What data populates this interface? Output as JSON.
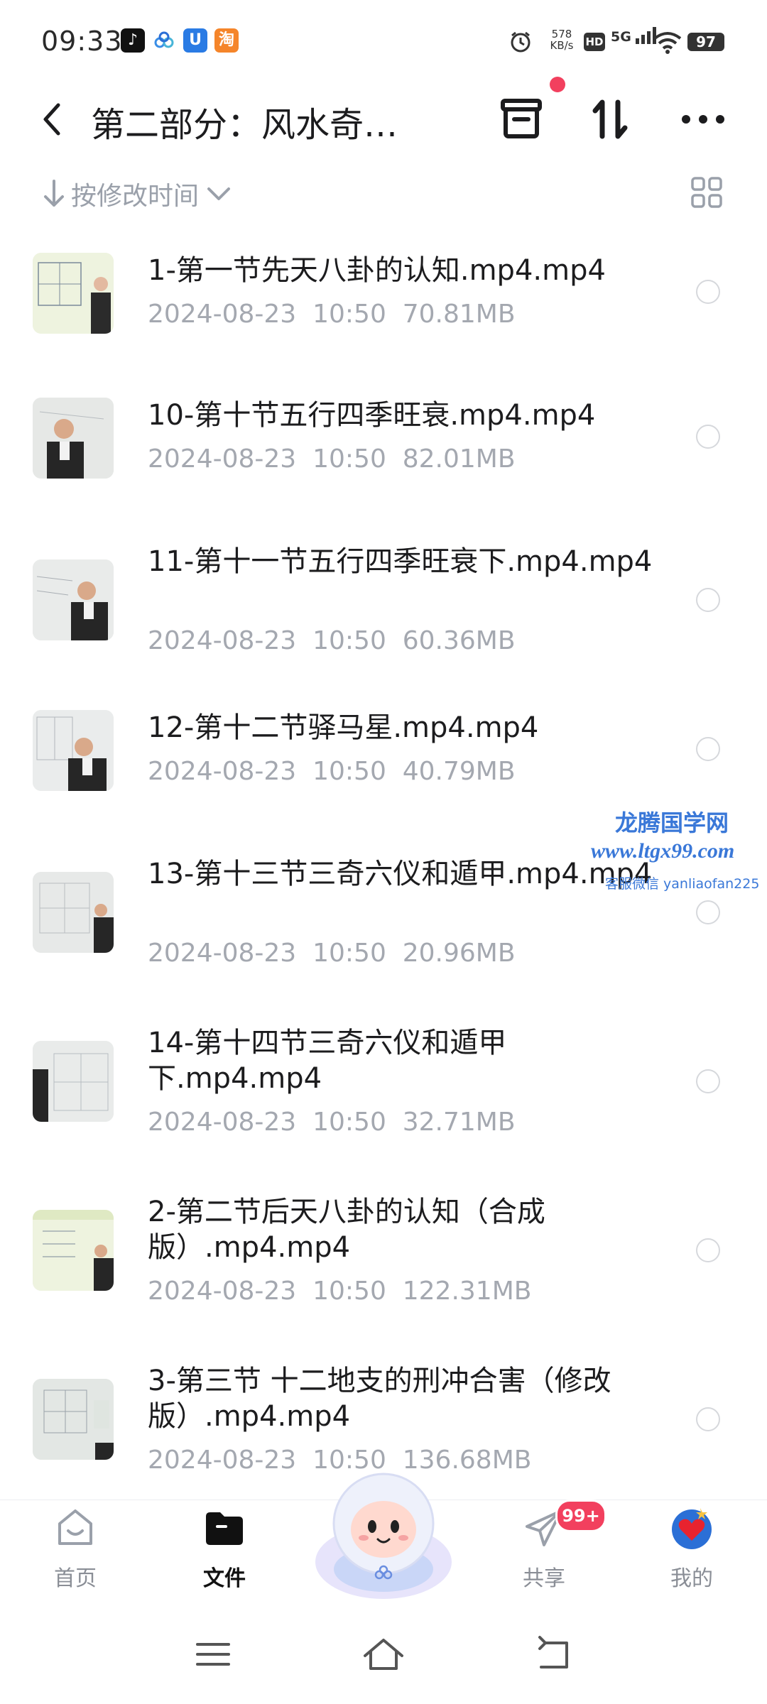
{
  "status_bar": {
    "time": "09:33",
    "apps": [
      "tiktok-icon",
      "cloud-icon",
      "shield-icon",
      "taobao-icon"
    ],
    "app_taobao": "淘",
    "speed_value": "578",
    "speed_unit": "KB/s",
    "hd": "HD",
    "network": "5G",
    "battery": "97"
  },
  "header": {
    "title": "第二部分：风水奇…"
  },
  "sort": {
    "label": "按修改时间"
  },
  "files": [
    {
      "name": "1-第一节先天八卦的认知.mp4.mp4",
      "date": "2024-08-23",
      "time": "10:50",
      "size": "70.81MB"
    },
    {
      "name": "10-第十节五行四季旺衰.mp4.mp4",
      "date": "2024-08-23",
      "time": "10:50",
      "size": "82.01MB"
    },
    {
      "name": "11-第十一节五行四季旺衰下.mp4.mp4",
      "date": "2024-08-23",
      "time": "10:50",
      "size": "60.36MB"
    },
    {
      "name": "12-第十二节驿马星.mp4.mp4",
      "date": "2024-08-23",
      "time": "10:50",
      "size": "40.79MB"
    },
    {
      "name": "13-第十三节三奇六仪和遁甲.mp4.mp4",
      "date": "2024-08-23",
      "time": "10:50",
      "size": "20.96MB"
    },
    {
      "name": "14-第十四节三奇六仪和遁甲下.mp4.mp4",
      "date": "2024-08-23",
      "time": "10:50",
      "size": "32.71MB"
    },
    {
      "name": "2-第二节后天八卦的认知（合成版）.mp4.mp4",
      "date": "2024-08-23",
      "time": "10:50",
      "size": "122.31MB"
    },
    {
      "name": "3-第三节 十二地支的刑冲合害（修改版）.mp4.mp4",
      "date": "2024-08-23",
      "time": "10:50",
      "size": "136.68MB"
    }
  ],
  "watermark": {
    "line1": "龙腾国学网",
    "line2": "www.ltgx99.com",
    "line3": "客服微信 yanliaofan225"
  },
  "bottom_nav": {
    "home": "首页",
    "files": "文件",
    "share": "共享",
    "share_badge": "99+",
    "mine": "我的"
  },
  "colors": {
    "accent_red": "#f2405e",
    "watermark_blue": "#3a78d8",
    "meta_gray": "#a4a8b0"
  }
}
